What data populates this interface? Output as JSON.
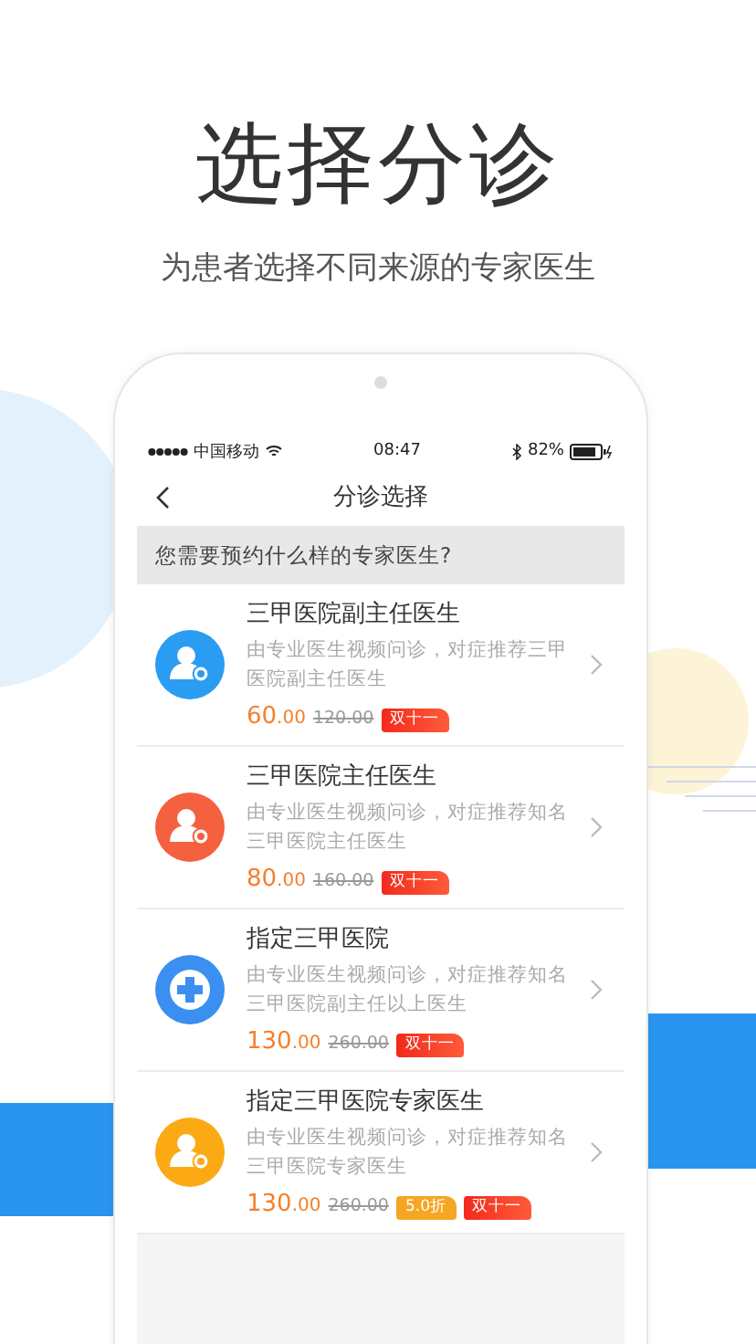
{
  "headline": "选择分诊",
  "subtitle": "为患者选择不同来源的专家医生",
  "status_bar": {
    "carrier": "中国移动",
    "time": "08:47",
    "battery": "82%"
  },
  "nav": {
    "title": "分诊选择"
  },
  "question": "您需要预约什么样的专家医生?",
  "options": [
    {
      "kind": "person",
      "color": "#2a9cf2",
      "title": "三甲医院副主任医生",
      "description": "由专业医生视频问诊，对症推荐三甲医院副主任医生",
      "price": "60",
      "price_decimals": ".00",
      "original_price": "120.00",
      "badges": [
        {
          "kind": "festival",
          "text": "双十一"
        }
      ]
    },
    {
      "kind": "person",
      "color": "#f5603f",
      "title": "三甲医院主任医生",
      "description": "由专业医生视频问诊，对症推荐知名三甲医院主任医生",
      "price": "80",
      "price_decimals": ".00",
      "original_price": "160.00",
      "badges": [
        {
          "kind": "festival",
          "text": "双十一"
        }
      ]
    },
    {
      "kind": "plus",
      "color": "#3a8ff0",
      "title": "指定三甲医院",
      "description": "由专业医生视频问诊，对症推荐知名三甲医院副主任以上医生",
      "price": "130",
      "price_decimals": ".00",
      "original_price": "260.00",
      "badges": [
        {
          "kind": "festival",
          "text": "双十一"
        }
      ]
    },
    {
      "kind": "person",
      "color": "#fbaa14",
      "title": "指定三甲医院专家医生",
      "description": "由专业医生视频问诊，对症推荐知名三甲医院专家医生",
      "price": "130",
      "price_decimals": ".00",
      "original_price": "260.00",
      "badges": [
        {
          "kind": "discount",
          "text": "5.0折"
        },
        {
          "kind": "festival",
          "text": "双十一"
        }
      ]
    }
  ]
}
